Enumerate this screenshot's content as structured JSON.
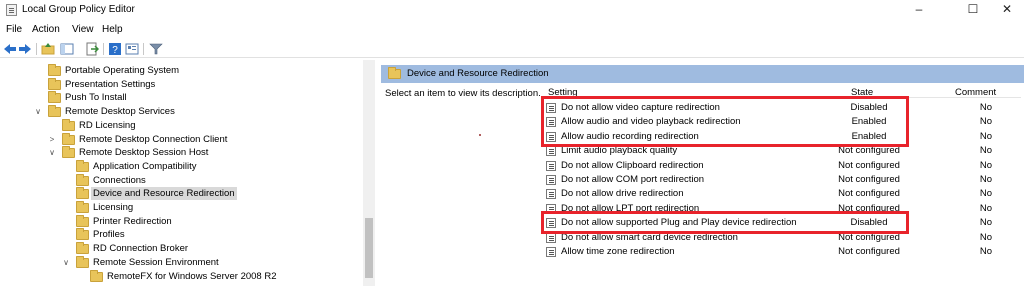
{
  "window": {
    "title": "Local Group Policy Editor",
    "minimize": "–",
    "maximize": "☐",
    "close": "✕"
  },
  "menu": [
    "File",
    "Action",
    "View",
    "Help"
  ],
  "toolbar": [
    "back-icon",
    "forward-icon",
    "up-folder-icon",
    "show-hide-tree-icon",
    "export-icon",
    "help-icon",
    "properties-icon",
    "filter-icon"
  ],
  "tree": [
    {
      "label": "Portable Operating System",
      "depth": 3,
      "expand": "",
      "selected": false
    },
    {
      "label": "Presentation Settings",
      "depth": 3,
      "expand": "",
      "selected": false
    },
    {
      "label": "Push To Install",
      "depth": 3,
      "expand": "",
      "selected": false
    },
    {
      "label": "Remote Desktop Services",
      "depth": 3,
      "expand": "∨",
      "selected": false
    },
    {
      "label": "RD Licensing",
      "depth": 4,
      "expand": "",
      "selected": false
    },
    {
      "label": "Remote Desktop Connection Client",
      "depth": 4,
      "expand": ">",
      "selected": false
    },
    {
      "label": "Remote Desktop Session Host",
      "depth": 4,
      "expand": "∨",
      "selected": false
    },
    {
      "label": "Application Compatibility",
      "depth": 5,
      "expand": "",
      "selected": false
    },
    {
      "label": "Connections",
      "depth": 5,
      "expand": "",
      "selected": false
    },
    {
      "label": "Device and Resource Redirection",
      "depth": 5,
      "expand": "",
      "selected": true
    },
    {
      "label": "Licensing",
      "depth": 5,
      "expand": "",
      "selected": false
    },
    {
      "label": "Printer Redirection",
      "depth": 5,
      "expand": "",
      "selected": false
    },
    {
      "label": "Profiles",
      "depth": 5,
      "expand": "",
      "selected": false
    },
    {
      "label": "RD Connection Broker",
      "depth": 5,
      "expand": "",
      "selected": false
    },
    {
      "label": "Remote Session Environment",
      "depth": 5,
      "expand": "∨",
      "selected": false
    },
    {
      "label": "RemoteFX for Windows Server 2008 R2",
      "depth": 6,
      "expand": "",
      "selected": false
    }
  ],
  "right": {
    "header": "Device and Resource Redirection",
    "description": "Select an item to view its description.",
    "columns": {
      "setting": "Setting",
      "state": "State",
      "comment": "Comment"
    },
    "rows": [
      {
        "setting": "Do not allow video capture redirection",
        "state": "Disabled",
        "comment": "No"
      },
      {
        "setting": "Allow audio and video playback redirection",
        "state": "Enabled",
        "comment": "No"
      },
      {
        "setting": "Allow audio recording redirection",
        "state": "Enabled",
        "comment": "No"
      },
      {
        "setting": "Limit audio playback quality",
        "state": "Not configured",
        "comment": "No"
      },
      {
        "setting": "Do not allow Clipboard redirection",
        "state": "Not configured",
        "comment": "No"
      },
      {
        "setting": "Do not allow COM port redirection",
        "state": "Not configured",
        "comment": "No"
      },
      {
        "setting": "Do not allow drive redirection",
        "state": "Not configured",
        "comment": "No"
      },
      {
        "setting": "Do not allow LPT port redirection",
        "state": "Not configured",
        "comment": "No"
      },
      {
        "setting": "Do not allow supported Plug and Play device redirection",
        "state": "Disabled",
        "comment": "No"
      },
      {
        "setting": "Do not allow smart card device redirection",
        "state": "Not configured",
        "comment": "No"
      },
      {
        "setting": "Allow time zone redirection",
        "state": "Not configured",
        "comment": "No"
      }
    ],
    "highlights": [
      {
        "first_row": 0,
        "last_row": 2
      },
      {
        "first_row": 8,
        "last_row": 8
      }
    ],
    "highlight_color": "#e8232b",
    "header_color": "#9fbbe0"
  }
}
